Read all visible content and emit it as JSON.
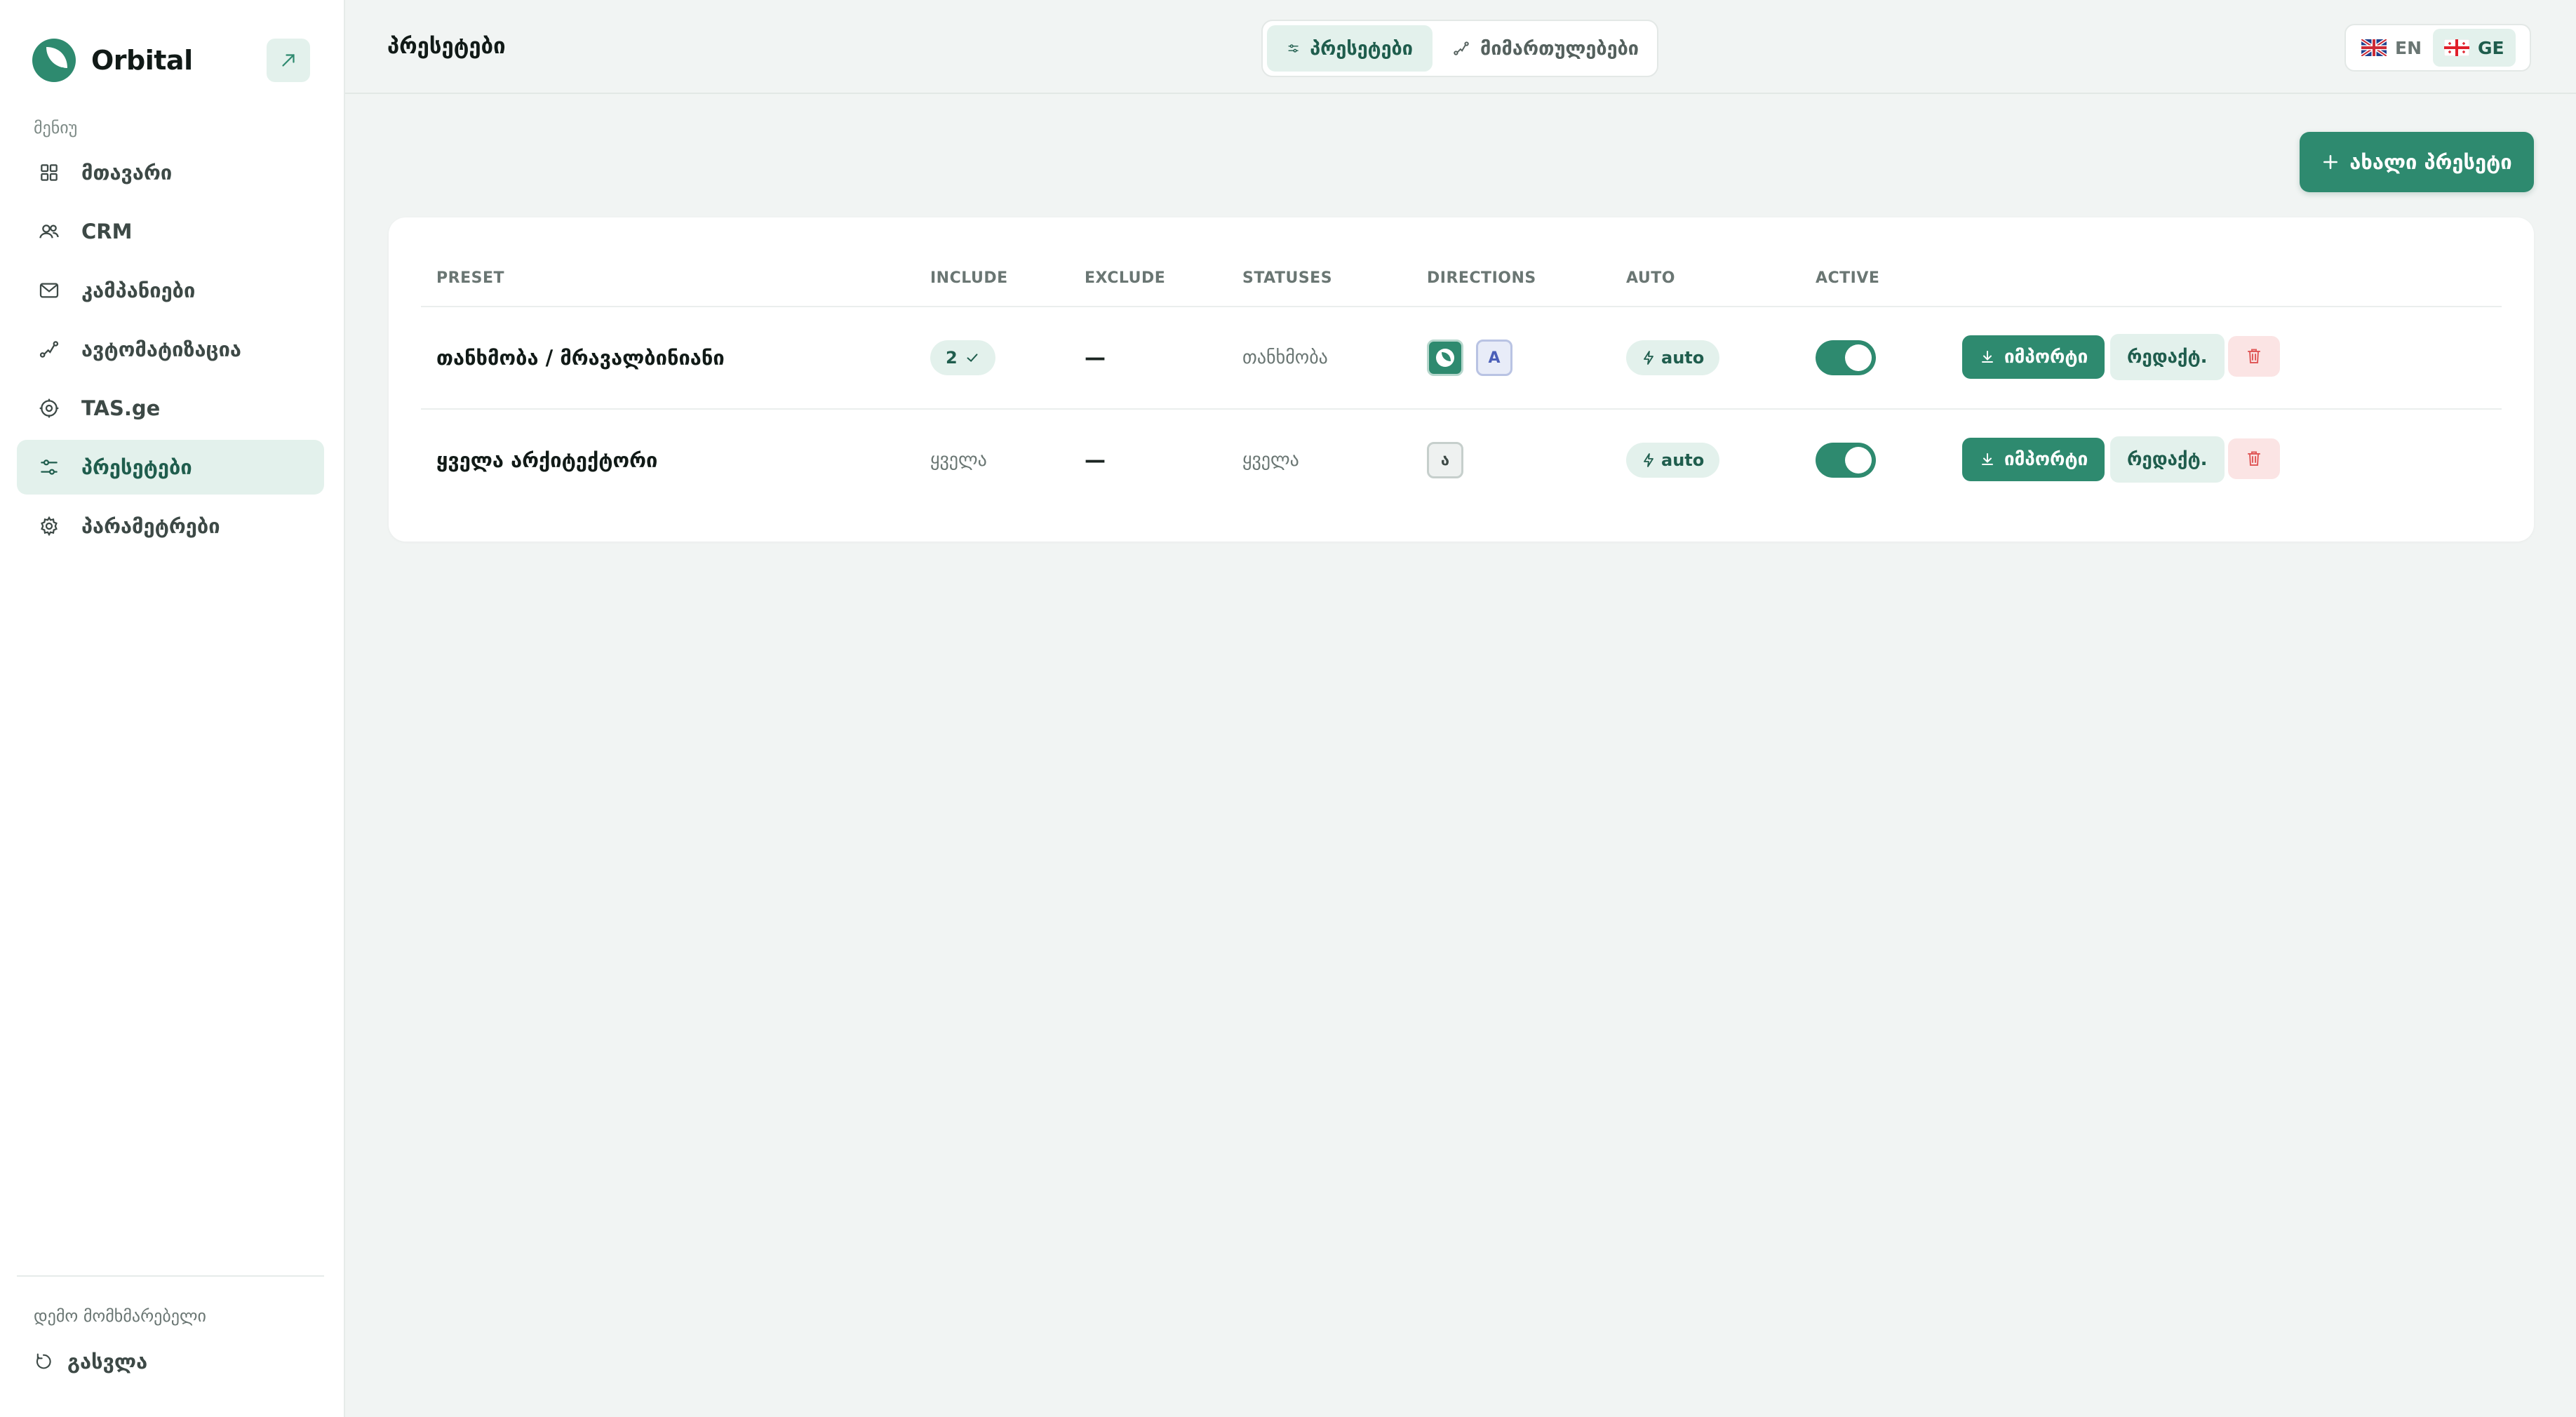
{
  "app": {
    "name": "Orbital"
  },
  "sidebar": {
    "section_label": "მენიუ",
    "items": [
      {
        "label": "მთავარი",
        "icon": "grid-icon",
        "active": false
      },
      {
        "label": "CRM",
        "icon": "users-icon",
        "active": false
      },
      {
        "label": "კამპანიები",
        "icon": "mail-icon",
        "active": false
      },
      {
        "label": "ავტომატიზაცია",
        "icon": "route-icon",
        "active": false
      },
      {
        "label": "TAS.ge",
        "icon": "target-icon",
        "active": false
      },
      {
        "label": "პრესეტები",
        "icon": "sliders-icon",
        "active": true
      },
      {
        "label": "პარამეტრები",
        "icon": "gear-icon",
        "active": false
      }
    ],
    "user_name": "დემო მომხმარებელი",
    "logout_label": "გასვლა"
  },
  "header": {
    "title": "პრესეტები",
    "tabs": [
      {
        "label": "პრესეტები",
        "active": true
      },
      {
        "label": "მიმართულებები",
        "active": false
      }
    ],
    "languages": [
      {
        "code": "EN",
        "active": false
      },
      {
        "code": "GE",
        "active": true
      }
    ]
  },
  "main": {
    "new_button_label": "ახალი პრესეტი",
    "table": {
      "columns": [
        "PRESET",
        "INCLUDE",
        "EXCLUDE",
        "STATUSES",
        "DIRECTIONS",
        "AUTO",
        "ACTIVE"
      ],
      "rows": [
        {
          "preset": "თანხმობა / მრავალბინიანი",
          "include": "2",
          "include_verified": true,
          "exclude": "—",
          "statuses": "თანხმობა",
          "directions": [
            {
              "type": "logo",
              "label": ""
            },
            {
              "type": "letter",
              "label": "A"
            }
          ],
          "auto": "auto",
          "active": true,
          "import_label": "იმპორტი",
          "edit_label": "რედაქტ."
        },
        {
          "preset": "ყველა არქიტექტორი",
          "include": "ყველა",
          "include_verified": false,
          "exclude": "—",
          "statuses": "ყველა",
          "directions": [
            {
              "type": "letter",
              "label": "ა"
            }
          ],
          "auto": "auto",
          "active": true,
          "import_label": "იმპორტი",
          "edit_label": "რედაქტ."
        }
      ]
    }
  },
  "colors": {
    "accent": "#2e8a6f",
    "accent_soft": "#e3f1ec",
    "danger_soft": "#fbe4e4",
    "danger": "#e05a5a",
    "background": "#f1f4f3"
  }
}
